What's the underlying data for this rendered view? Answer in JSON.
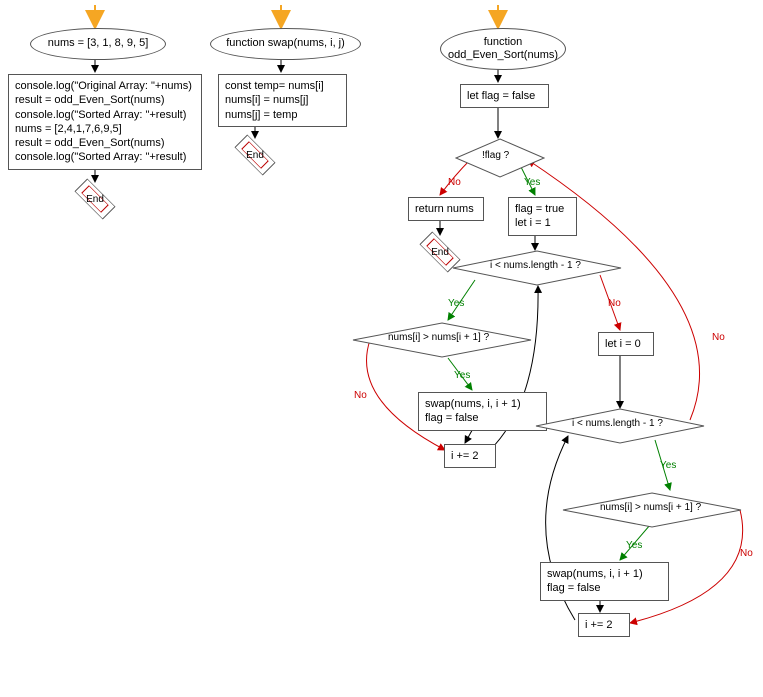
{
  "chart_data": {
    "type": "flowchart",
    "entry_arrows": [
      "entry-main",
      "entry-swap",
      "entry-sort"
    ],
    "nodes": [
      {
        "id": "n_main_start",
        "shape": "ellipse",
        "text": "nums = [3, 1, 8, 9, 5]"
      },
      {
        "id": "n_main_body",
        "shape": "box",
        "text": "console.log(\"Original Array: \"+nums)\nresult = odd_Even_Sort(nums)\nconsole.log(\"Sorted Array: \"+result)\nnums = [2,4,1,7,6,9,5]\nresult = odd_Even_Sort(nums)\nconsole.log(\"Sorted Array: \"+result)"
      },
      {
        "id": "n_main_end",
        "shape": "end",
        "text": "End"
      },
      {
        "id": "n_swap_start",
        "shape": "ellipse",
        "text": "function swap(nums, i, j)"
      },
      {
        "id": "n_swap_body",
        "shape": "box",
        "text": "const temp= nums[i]\nnums[i] = nums[j]\nnums[j] = temp"
      },
      {
        "id": "n_swap_end",
        "shape": "end",
        "text": "End"
      },
      {
        "id": "n_sort_start",
        "shape": "ellipse",
        "text": "function\nodd_Even_Sort(nums)"
      },
      {
        "id": "n_flag_false",
        "shape": "box",
        "text": "let flag = false"
      },
      {
        "id": "n_notflag",
        "shape": "diamond",
        "text": "!flag ?"
      },
      {
        "id": "n_return",
        "shape": "box",
        "text": "return nums"
      },
      {
        "id": "n_sort_end",
        "shape": "end",
        "text": "End"
      },
      {
        "id": "n_flag_true",
        "shape": "box",
        "text": "flag = true\nlet i = 1"
      },
      {
        "id": "n_loop1_cond",
        "shape": "diamond",
        "text": "i < nums.length - 1 ?"
      },
      {
        "id": "n_cmp1",
        "shape": "diamond",
        "text": "nums[i] > nums[i + 1] ?"
      },
      {
        "id": "n_swap1",
        "shape": "box",
        "text": "swap(nums, i, i + 1)\nflag = false"
      },
      {
        "id": "n_inc1",
        "shape": "box",
        "text": "i += 2"
      },
      {
        "id": "n_i0",
        "shape": "box",
        "text": "let i = 0"
      },
      {
        "id": "n_loop2_cond",
        "shape": "diamond",
        "text": "i < nums.length - 1 ?"
      },
      {
        "id": "n_cmp2",
        "shape": "diamond",
        "text": "nums[i] > nums[i + 1] ?"
      },
      {
        "id": "n_swap2",
        "shape": "box",
        "text": "swap(nums, i, i + 1)\nflag = false"
      },
      {
        "id": "n_inc2",
        "shape": "box",
        "text": "i += 2"
      }
    ],
    "edges": [
      {
        "from": "n_main_start",
        "to": "n_main_body"
      },
      {
        "from": "n_main_body",
        "to": "n_main_end"
      },
      {
        "from": "n_swap_start",
        "to": "n_swap_body"
      },
      {
        "from": "n_swap_body",
        "to": "n_swap_end"
      },
      {
        "from": "n_sort_start",
        "to": "n_flag_false"
      },
      {
        "from": "n_flag_false",
        "to": "n_notflag"
      },
      {
        "from": "n_notflag",
        "to": "n_return",
        "label": "No",
        "color": "red"
      },
      {
        "from": "n_return",
        "to": "n_sort_end"
      },
      {
        "from": "n_notflag",
        "to": "n_flag_true",
        "label": "Yes",
        "color": "green"
      },
      {
        "from": "n_flag_true",
        "to": "n_loop1_cond"
      },
      {
        "from": "n_loop1_cond",
        "to": "n_cmp1",
        "label": "Yes",
        "color": "green"
      },
      {
        "from": "n_cmp1",
        "to": "n_swap1",
        "label": "Yes",
        "color": "green"
      },
      {
        "from": "n_swap1",
        "to": "n_inc1"
      },
      {
        "from": "n_cmp1",
        "to": "n_inc1",
        "label": "No",
        "color": "red"
      },
      {
        "from": "n_inc1",
        "to": "n_loop1_cond"
      },
      {
        "from": "n_loop1_cond",
        "to": "n_i0",
        "label": "No",
        "color": "red"
      },
      {
        "from": "n_i0",
        "to": "n_loop2_cond"
      },
      {
        "from": "n_loop2_cond",
        "to": "n_cmp2",
        "label": "Yes",
        "color": "green"
      },
      {
        "from": "n_cmp2",
        "to": "n_swap2",
        "label": "Yes",
        "color": "green"
      },
      {
        "from": "n_swap2",
        "to": "n_inc2"
      },
      {
        "from": "n_cmp2",
        "to": "n_inc2",
        "label": "No",
        "color": "red"
      },
      {
        "from": "n_inc2",
        "to": "n_loop2_cond"
      },
      {
        "from": "n_loop2_cond",
        "to": "n_notflag",
        "label": "No",
        "color": "red"
      }
    ]
  },
  "labels": {
    "end": "End",
    "yes": "Yes",
    "no": "No"
  }
}
